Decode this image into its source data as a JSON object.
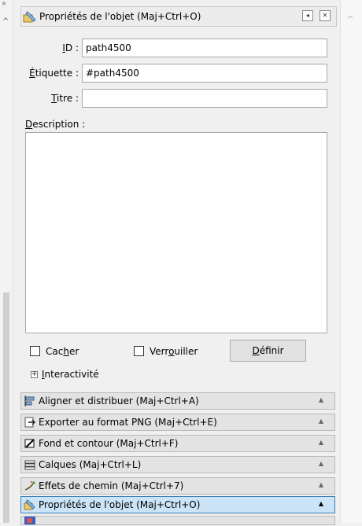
{
  "panel": {
    "title": "Propriétés de l'objet (Maj+Ctrl+O)",
    "fields": {
      "id": {
        "label_pre": "",
        "label_key": "I",
        "label_post": "D :",
        "value": "path4500"
      },
      "etiquette": {
        "label_pre": "",
        "label_key": "É",
        "label_post": "tiquette :",
        "value": "#path4500"
      },
      "titre": {
        "label_pre": "",
        "label_key": "T",
        "label_post": "itre :",
        "value": ""
      }
    },
    "description": {
      "label_key": "D",
      "label_post": "escription :",
      "value": ""
    },
    "hide": {
      "pre": "Cac",
      "key": "h",
      "post": "er",
      "checked": false
    },
    "lock": {
      "pre": "Verr",
      "key": "o",
      "post": "uiller",
      "checked": false
    },
    "set_button": {
      "pre": "",
      "key": "D",
      "post": "éfinir"
    },
    "interactivity": {
      "key": "I",
      "post": "nteractivité",
      "expander": "+"
    }
  },
  "dock": [
    {
      "label": "Aligner et distribuer (Maj+Ctrl+A)",
      "icon": "align-icon",
      "active": false
    },
    {
      "label": "Exporter au format PNG (Maj+Ctrl+E)",
      "icon": "export-png-icon",
      "active": false
    },
    {
      "label": "Fond et contour (Maj+Ctrl+F)",
      "icon": "fill-stroke-icon",
      "active": false
    },
    {
      "label": "Calques (Maj+Ctrl+L)",
      "icon": "layers-icon",
      "active": false
    },
    {
      "label": "Effets de chemin (Maj+Ctrl+7)",
      "icon": "path-effects-icon",
      "active": false
    },
    {
      "label": "Propriétés de l'objet (Maj+Ctrl+O)",
      "icon": "object-properties-icon",
      "active": true
    }
  ],
  "colors": {
    "active_tab": "#cce4f7",
    "active_border": "#3c7fb1"
  }
}
